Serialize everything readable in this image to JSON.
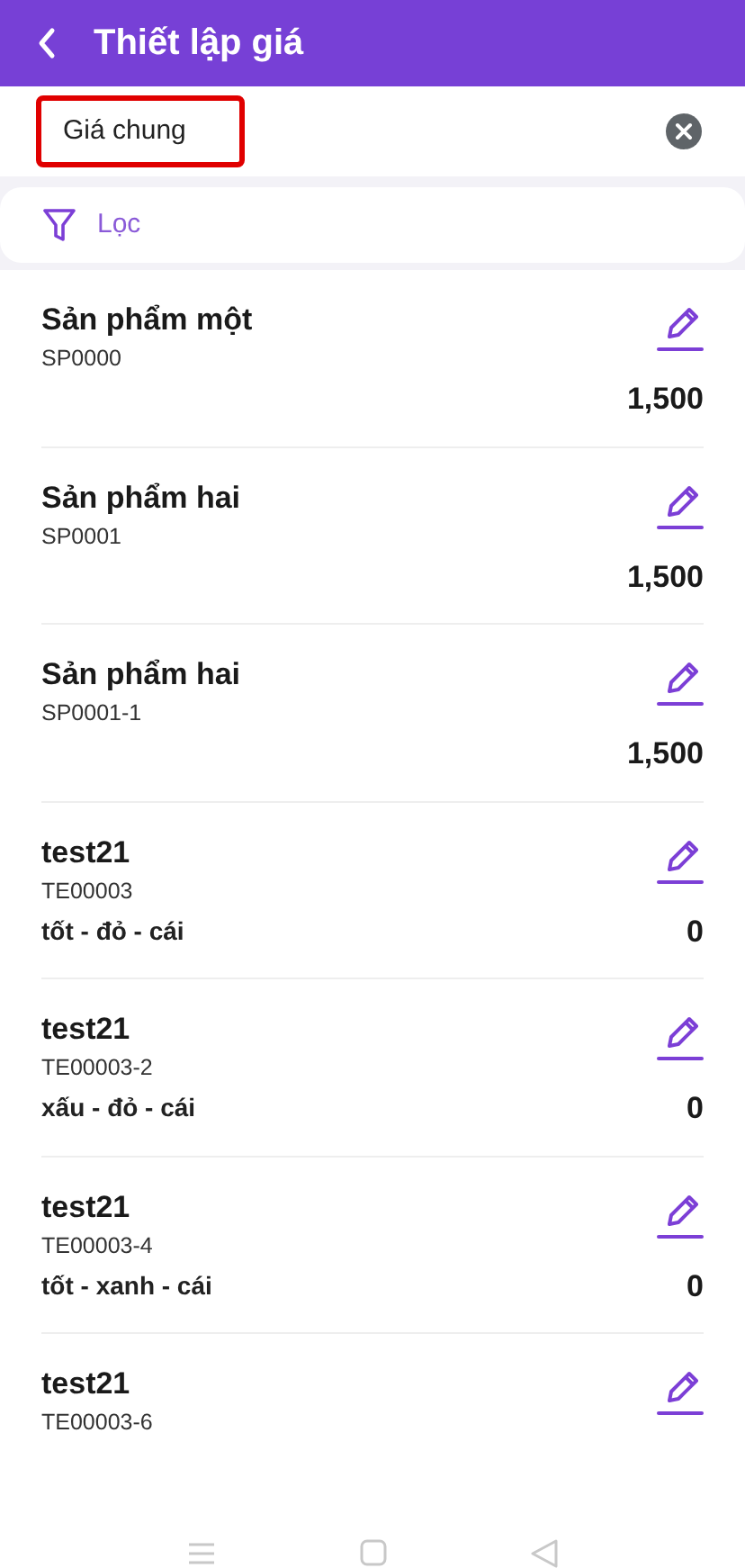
{
  "header": {
    "title": "Thiết lập giá"
  },
  "price_list": {
    "value": "Giá chung",
    "highlighted": true
  },
  "filter": {
    "label": "Lọc"
  },
  "products": [
    {
      "name": "Sản phẩm một",
      "code": "SP0000",
      "price": "1,500"
    },
    {
      "name": "Sản phẩm hai",
      "code": "SP0001",
      "price": "1,500"
    },
    {
      "name": "Sản phẩm hai",
      "code": "SP0001-1",
      "price": "1,500"
    },
    {
      "name": "test21",
      "code": "TE00003",
      "variant": "tốt - đỏ - cái",
      "price": "0"
    },
    {
      "name": "test21",
      "code": "TE00003-2",
      "variant": "xấu - đỏ - cái",
      "price": "0"
    },
    {
      "name": "test21",
      "code": "TE00003-4",
      "variant": "tốt - xanh - cái",
      "price": "0"
    },
    {
      "name": "test21",
      "code": "TE00003-6"
    }
  ]
}
